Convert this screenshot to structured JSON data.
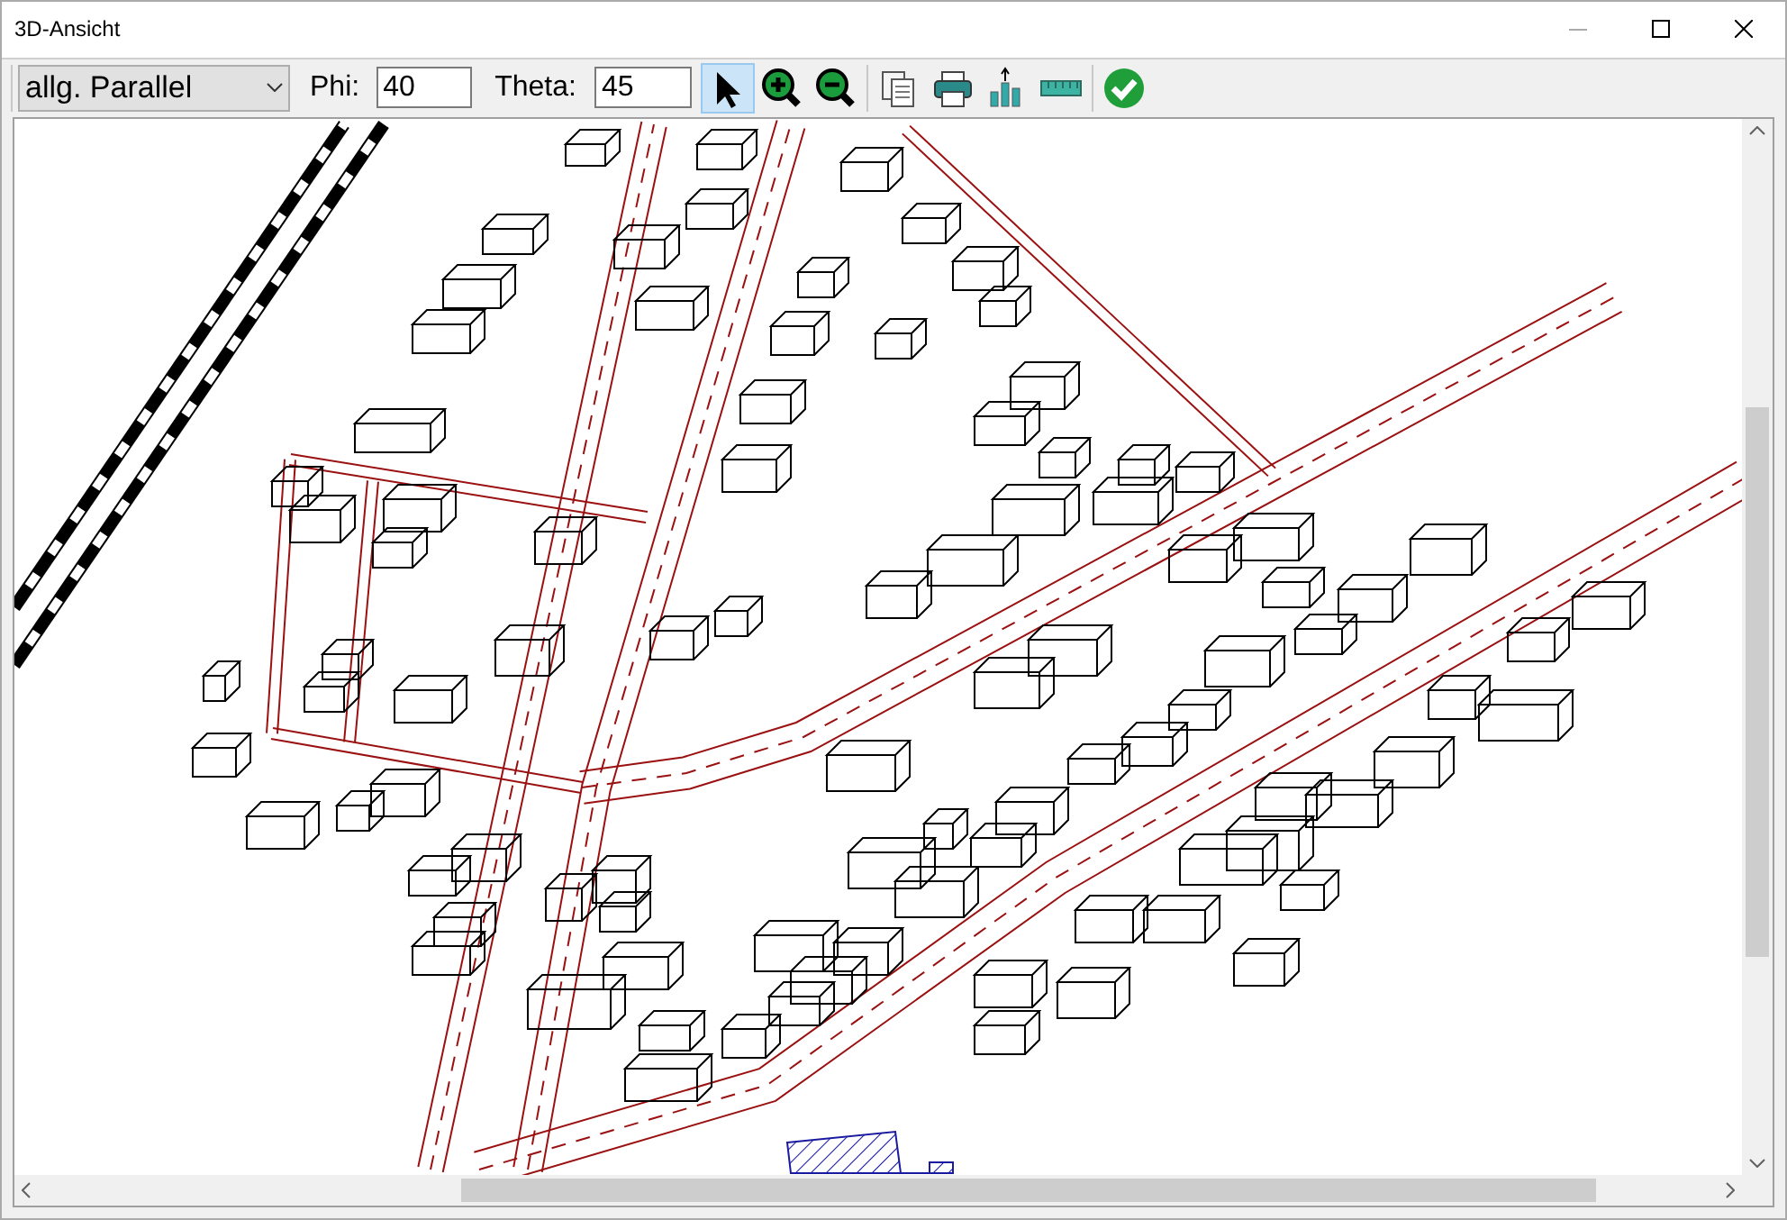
{
  "window": {
    "title": "3D-Ansicht"
  },
  "toolbar": {
    "projection": {
      "value": "allg. Parallel"
    },
    "phi": {
      "label": "Phi:",
      "value": "40"
    },
    "theta": {
      "label": "Theta:",
      "value": "45"
    },
    "tools": [
      {
        "kind": "pointer",
        "selected": true
      },
      {
        "kind": "zoom-in",
        "selected": false
      },
      {
        "kind": "zoom-out",
        "selected": false
      },
      {
        "kind": "copy",
        "selected": false
      },
      {
        "kind": "print",
        "selected": false
      },
      {
        "kind": "chart",
        "selected": false
      },
      {
        "kind": "ruler",
        "selected": false
      }
    ],
    "actions": [
      {
        "kind": "ok"
      }
    ]
  }
}
